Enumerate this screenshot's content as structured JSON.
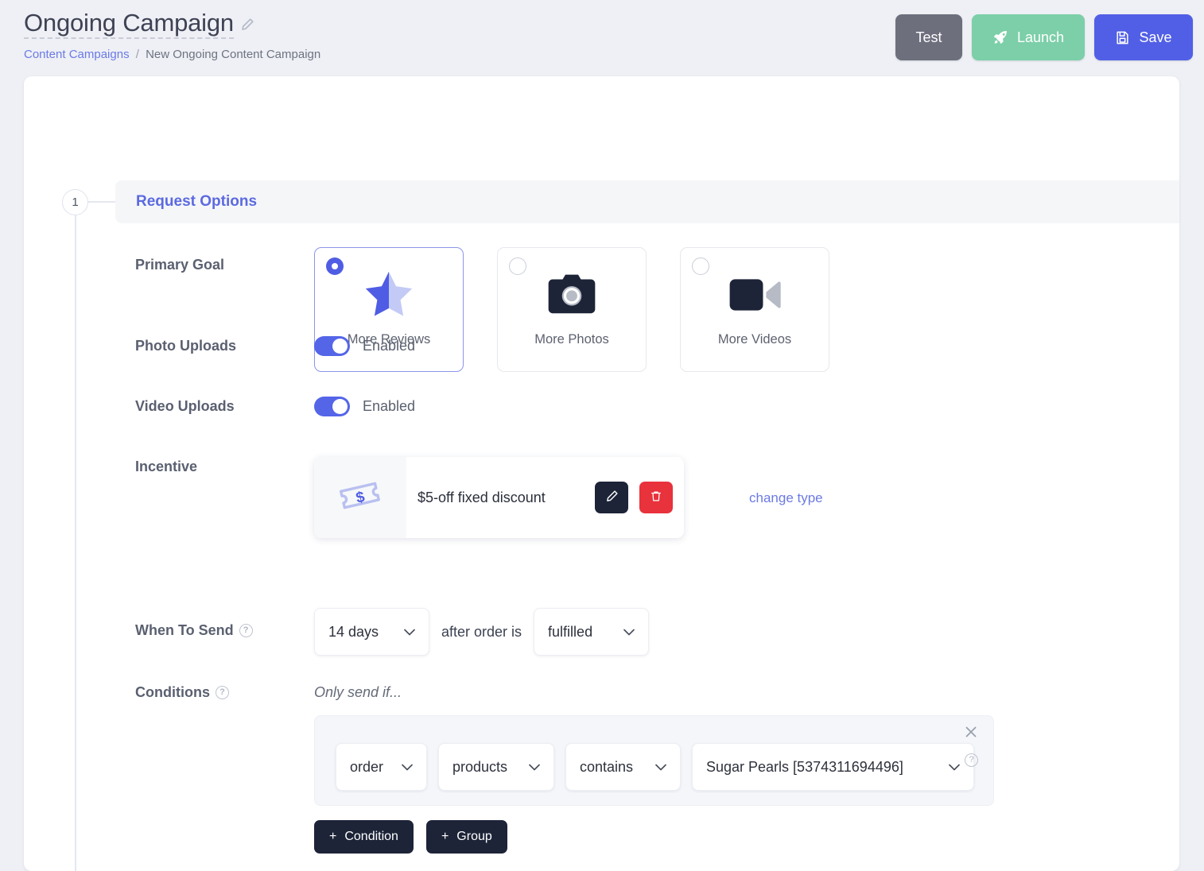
{
  "header": {
    "title": "Ongoing Campaign",
    "edit_icon": "pencil-icon",
    "breadcrumb": {
      "parent": "Content Campaigns",
      "separator": "/",
      "current": "New Ongoing Content Campaign"
    },
    "buttons": {
      "test": "Test",
      "launch": "Launch",
      "save": "Save"
    },
    "colors": {
      "test_bg": "#6d6f7d",
      "launch_bg": "#7ccfa8",
      "save_bg": "#515fe6"
    }
  },
  "section": {
    "step_number": "1",
    "title": "Request Options"
  },
  "primary_goal": {
    "label": "Primary Goal",
    "options": [
      {
        "label": "More Reviews",
        "icon": "half-star-icon",
        "selected": true
      },
      {
        "label": "More Photos",
        "icon": "camera-icon",
        "selected": false
      },
      {
        "label": "More Videos",
        "icon": "video-camera-icon",
        "selected": false
      }
    ]
  },
  "photo_uploads": {
    "label": "Photo Uploads",
    "state": "Enabled",
    "on": true
  },
  "video_uploads": {
    "label": "Video Uploads",
    "state": "Enabled",
    "on": true
  },
  "incentive": {
    "label": "Incentive",
    "icon": "coupon-dollar-icon",
    "value": "$5-off fixed discount",
    "edit_icon": "pencil-icon",
    "delete_icon": "trash-icon",
    "change_type_link": "change type"
  },
  "when_to_send": {
    "label": "When To Send",
    "help_icon": "question-circle-icon",
    "delay": "14 days",
    "middle_text": "after order is",
    "status": "fulfilled"
  },
  "conditions": {
    "label": "Conditions",
    "help_icon": "question-circle-icon",
    "prefix": "Only send if...",
    "rows": [
      {
        "subject": "order",
        "field": "products",
        "operator": "contains",
        "value": "Sugar Pearls [5374311694496]",
        "close_icon": "close-icon",
        "help_icon": "question-circle-icon"
      }
    ],
    "add_condition": "Condition",
    "add_group": "Group",
    "plus_glyph": "+"
  },
  "accent_colors": {
    "primary_blue": "#515fe6",
    "link_blue": "#6b7ae5",
    "section_blue": "#5b6ae0",
    "dark_navy": "#1d2438",
    "danger_red": "#e8323c",
    "green": "#7ccfa8"
  }
}
